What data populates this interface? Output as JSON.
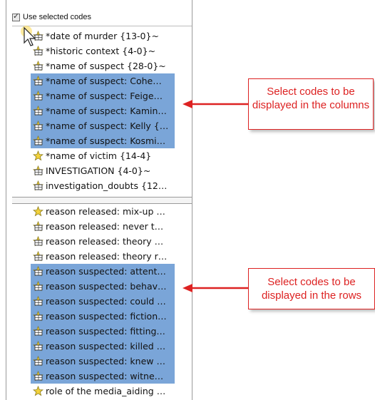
{
  "header": {
    "checkbox_label": "Use selected codes",
    "checked": true
  },
  "top_list": [
    {
      "label": "*date of murder {13-0}~",
      "selected": false,
      "icon": "code-icon"
    },
    {
      "label": "*historic context {4-0}~",
      "selected": false,
      "icon": "code-icon"
    },
    {
      "label": "*name of suspect {28-0}~",
      "selected": false,
      "icon": "code-icon"
    },
    {
      "label": "*name of suspect: Cohe…",
      "selected": true,
      "icon": "code-icon"
    },
    {
      "label": "*name of suspect: Feige…",
      "selected": true,
      "icon": "code-icon"
    },
    {
      "label": "*name of suspect: Kamin…",
      "selected": true,
      "icon": "code-icon"
    },
    {
      "label": "*name of suspect: Kelly {…",
      "selected": true,
      "icon": "code-icon"
    },
    {
      "label": "*name of suspect: Kosmi…",
      "selected": true,
      "icon": "code-icon"
    },
    {
      "label": "*name of victim {14-4}",
      "selected": false,
      "icon": "code-star-icon"
    },
    {
      "label": "INVESTIGATION {4-0}~",
      "selected": false,
      "icon": "code-icon"
    },
    {
      "label": "investigation_doubts {12…",
      "selected": false,
      "icon": "code-icon"
    }
  ],
  "bottom_list": [
    {
      "label": "reason released: mix-up …",
      "selected": false,
      "icon": "code-star-icon"
    },
    {
      "label": "reason released: never t…",
      "selected": false,
      "icon": "code-icon"
    },
    {
      "label": "reason released: theory …",
      "selected": false,
      "icon": "code-icon"
    },
    {
      "label": "reason released: theory r…",
      "selected": false,
      "icon": "code-icon"
    },
    {
      "label": "reason suspected: attent…",
      "selected": true,
      "icon": "code-icon"
    },
    {
      "label": "reason suspected: behav…",
      "selected": true,
      "icon": "code-icon"
    },
    {
      "label": "reason suspected: could …",
      "selected": true,
      "icon": "code-icon"
    },
    {
      "label": "reason suspected: fiction…",
      "selected": true,
      "icon": "code-icon"
    },
    {
      "label": "reason suspected: fitting…",
      "selected": true,
      "icon": "code-icon"
    },
    {
      "label": "reason suspected: killed …",
      "selected": true,
      "icon": "code-icon"
    },
    {
      "label": "reason suspected: knew …",
      "selected": true,
      "icon": "code-icon"
    },
    {
      "label": "reason suspected: witne…",
      "selected": true,
      "icon": "code-icon"
    },
    {
      "label": "role of the media_aiding …",
      "selected": false,
      "icon": "code-star-icon"
    }
  ],
  "callouts": {
    "columns": "Select codes to be displayed in the columns",
    "rows": "Select codes to be displayed in the rows"
  },
  "colors": {
    "selection": "#7aa5d8",
    "callout_red": "#dd2222"
  }
}
